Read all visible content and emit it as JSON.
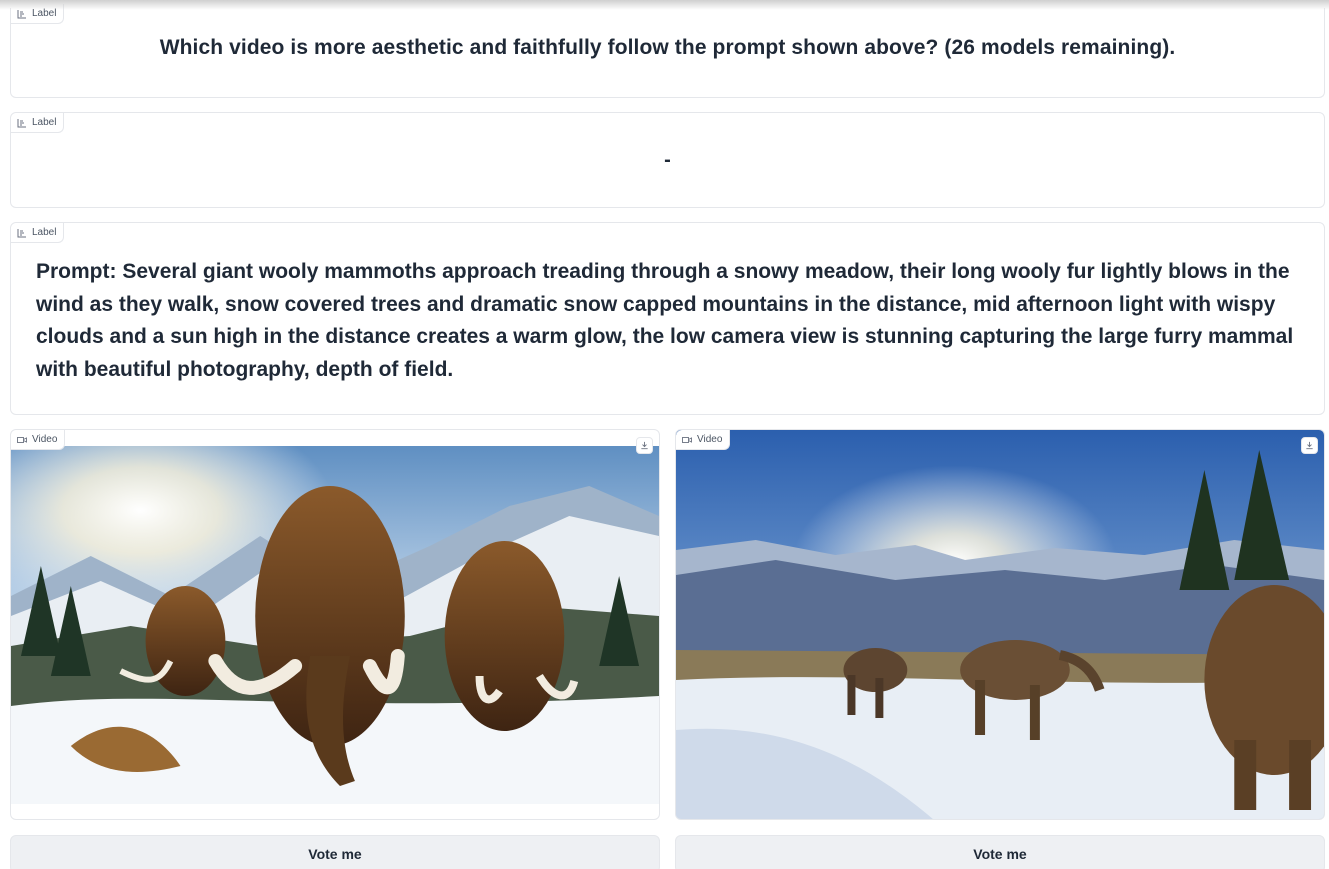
{
  "labels": {
    "tag": "Label",
    "question": "Which video is more aesthetic and faithfully follow the prompt shown above? (26 models remaining).",
    "result": "-",
    "prompt": "Prompt: Several giant wooly mammoths approach treading through a snowy meadow, their long wooly fur lightly blows in the wind as they walk, snow covered trees and dramatic snow capped mountains in the distance, mid afternoon light with wispy clouds and a sun high in the distance creates a warm glow, the low camera view is stunning capturing the large furry mammal with beautiful photography, depth of field."
  },
  "videos": [
    {
      "tag": "Video",
      "vote_label": "Vote me"
    },
    {
      "tag": "Video",
      "vote_label": "Vote me"
    }
  ],
  "icons": {
    "label_tag": "bar-chart-icon",
    "video_tag": "video-camera-icon",
    "download": "download-icon"
  },
  "colors": {
    "panel_border": "#e5e7eb",
    "button_bg": "#eef0f3",
    "text": "#1f2937"
  }
}
